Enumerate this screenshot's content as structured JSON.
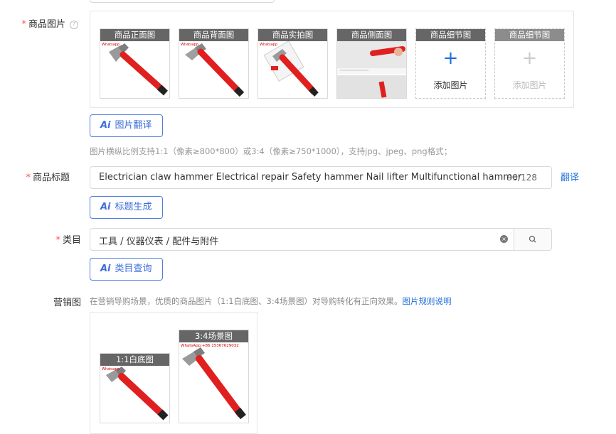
{
  "product_images": {
    "label": "商品图片",
    "help_icon": "question-circle-icon",
    "thumbnails": [
      {
        "caption": "商品正面图",
        "kind": "hammer-front"
      },
      {
        "caption": "商品背面图",
        "kind": "hammer-back"
      },
      {
        "caption": "商品实拍图",
        "kind": "hammer-package"
      },
      {
        "caption": "商品侧面图",
        "kind": "hammer-side"
      }
    ],
    "add_slots": [
      {
        "caption": "商品细节图",
        "add_text": "添加图片"
      },
      {
        "caption": "商品细节图",
        "add_text": "添加图片"
      }
    ],
    "watermark": "Whatsapp",
    "translate_button": "图片翻译",
    "hint": "图片横纵比例支持1:1（像素≥800*800）或3:4（像素≥750*1000），支持jpg、jpeg、png格式；"
  },
  "title": {
    "label": "商品标题",
    "value": "Electrician claw hammer Electrical repair Safety hammer Nail lifter Multifunctional hammer",
    "counter": "90/128",
    "translate_link": "翻译",
    "generate_button": "标题生成"
  },
  "category": {
    "label": "类目",
    "value": "工具 / 仪器仪表 / 配件与附件",
    "query_button": "类目查询"
  },
  "marketing": {
    "label": "营销图",
    "hint": "在营销导购场景，优质的商品图片（1:1白底图、3:4场景图）对导购转化有正向效果。",
    "rules_link": "图片规则说明",
    "images": [
      {
        "caption": "1:1白底图"
      },
      {
        "caption": "3:4场景图",
        "watermark": "WhatsApp:+86 15367629032"
      }
    ]
  },
  "ai_mark": "Ai",
  "colors": {
    "accent": "#1f6fd9",
    "required": "#ff4d4f",
    "hammer_red": "#e0201f"
  }
}
